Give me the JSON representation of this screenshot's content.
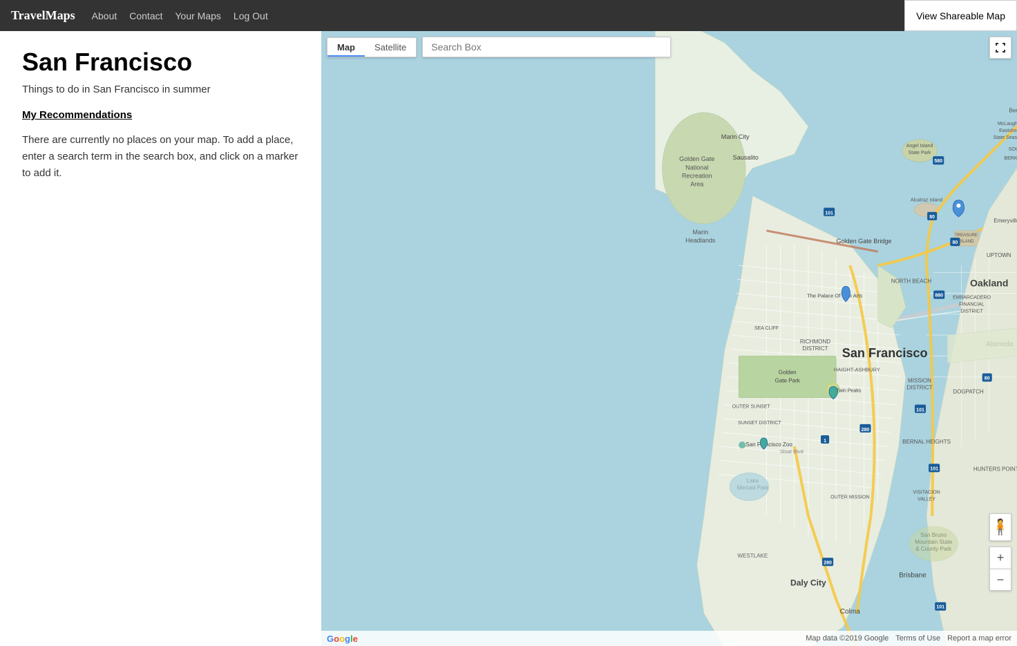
{
  "nav": {
    "brand": "TravelMaps",
    "links": [
      {
        "label": "About",
        "name": "about-link"
      },
      {
        "label": "Contact",
        "name": "contact-link"
      },
      {
        "label": "Your Maps",
        "name": "your-maps-link"
      },
      {
        "label": "Log Out",
        "name": "logout-link"
      }
    ],
    "share_button": "View Shareable Map"
  },
  "left_panel": {
    "title": "San Francisco",
    "subtitle": "Things to do in San Francisco in summer",
    "recommendations_heading": "My Recommendations",
    "empty_message": "There are currently no places on your map. To add a place, enter a search term in the search box, and click on a marker to add it."
  },
  "map": {
    "search_placeholder": "Search Box",
    "type_buttons": [
      {
        "label": "Map",
        "active": true
      },
      {
        "label": "Satellite",
        "active": false
      }
    ],
    "footer": {
      "attribution": "Map data ©2019 Google",
      "terms": "Terms of Use",
      "report": "Report a map error"
    },
    "zoom_plus": "+",
    "zoom_minus": "−"
  }
}
